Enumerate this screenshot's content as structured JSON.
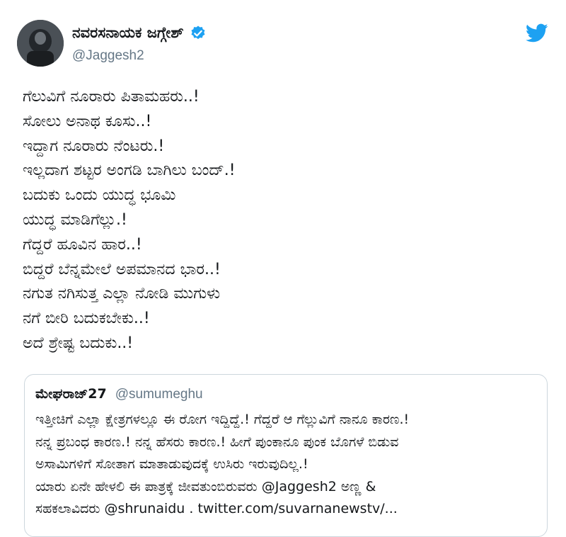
{
  "user": {
    "display_name": "ನವರಸನಾಯಕ ಜಗ್ಗೇಶ್",
    "handle": "@Jaggesh2",
    "verified": true
  },
  "tweet": {
    "lines": [
      "ಗೆಲುವಿಗೆ ನೂರಾರು ಪಿತಾಮಹರು..!",
      "ಸೋಲು ಅನಾಥ ಕೂಸು..!",
      "ಇದ್ದಾಗ ನೂರಾರು ನೆಂಟರು.!",
      "ಇಲ್ಲದಾಗ ಶಟ್ಟರ ಅಂಗಡಿ ಬಾಗಿಲು ಬಂದ್.!",
      "ಬದುಕು ಒಂದು ಯುದ್ಧ ಭೂಮಿ",
      "ಯುದ್ಧ ಮಾಡಿಗೆಲ್ಲು.!",
      "ಗೆದ್ದರೆ ಹೂವಿನ ಹಾರ..!",
      "ಬಿದ್ದರೆ ಬೆನ್ನಮೇಲೆ ಅಪಮಾನದ ಭಾರ..!",
      "ನಗುತ ನಗಿಸುತ್ತ ಎಲ್ಲಾ ನೋಡಿ ಮುಗುಳು",
      "ನಗೆ ಬೀರಿ ಬದುಕಬೇಕು..!",
      "ಅದೆ ಶ್ರೇಷ್ಟ ಬದುಕು..!"
    ]
  },
  "quoted": {
    "display_name": "ಮೇಘರಾಜ್27",
    "handle": "@sumumeghu",
    "lines": [
      "ಇತ್ತೀಚಿಗೆ ಎಲ್ಲಾ ಕ್ಷೇತ್ರಗಳಲ್ಲೂ ಈ ರೋಗ ಇದ್ದಿದ್ದೆ.! ಗೆದ್ದರೆ ಆ ಗೆಲ್ಲುವಿಗೆ ನಾನೂ ಕಾರಣ.!",
      "ನನ್ನ ಪ್ರಬಂಧ ಕಾರಣ.! ನನ್ನ ಹೆಸರು ಕಾರಣ.! ಹೀಗೆ ಪುಂಕಾನೂ ಪುಂಕ ಬೊಗಳೆ ಬಿಡುವ",
      "ಅಸಾಮಿಗಳಿಗೆ ಸೋತಾಗ ಮಾತಾಡುವುದಕ್ಕೆ ಉಸಿರು ಇರುವುದಿಲ್ಲ.!",
      "ಯಾರು ಏನೇ ಹೇಳಲಿ ಈ ಪಾತ್ರಕ್ಕೆ ಜೀವತುಂಬಿರುವರು @Jaggesh2 ಅಣ್ಣ &",
      "ಸಹಕಲಾವಿದರು @shrunaidu . twitter.com/suvarnanewstv/..."
    ]
  },
  "colors": {
    "twitter_blue": "#1da1f2",
    "text": "#14171a",
    "secondary": "#657786",
    "border": "#ccd6dd"
  },
  "icons": [
    "verified-badge-icon",
    "twitter-bird-icon"
  ]
}
